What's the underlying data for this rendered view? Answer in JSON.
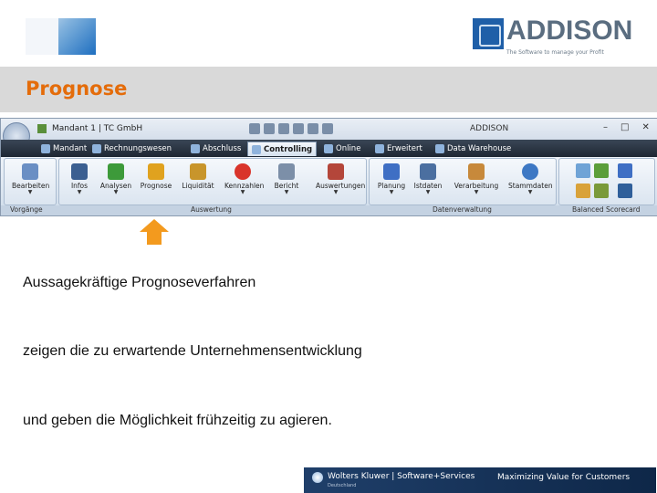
{
  "header": {
    "title": "Prognose",
    "logo_word": "ADDISON",
    "logo_tagline": "The Software to manage your Profit",
    "accent_color": "#e46c0a"
  },
  "app": {
    "window_title": "Mandant 1 | TC GmbH",
    "app_name": "ADDISON",
    "window_buttons": [
      "–",
      "□",
      "✕"
    ],
    "tabs": [
      {
        "label": "Mandant",
        "icon": "client-icon",
        "active": false
      },
      {
        "label": "Rechnungswesen",
        "icon": "ledger-icon",
        "active": false
      },
      {
        "label": "Abschluss",
        "icon": "closing-icon",
        "active": false
      },
      {
        "label": "Controlling",
        "icon": "controlling-icon",
        "active": true
      },
      {
        "label": "Online",
        "icon": "globe-icon",
        "active": false
      },
      {
        "label": "Erweitert",
        "icon": "gear-icon",
        "active": false
      },
      {
        "label": "Data Warehouse",
        "icon": "warehouse-icon",
        "active": false
      }
    ],
    "ribbon_buttons": [
      {
        "label": "Bearbeiten",
        "icon": "edit-icon",
        "color": "#6a8fc4"
      },
      {
        "label": "Infos",
        "icon": "info-icon",
        "color": "#3b5f91"
      },
      {
        "label": "Analysen",
        "icon": "traffic-light-icon",
        "color": "#3d9a3a"
      },
      {
        "label": "Prognose",
        "icon": "forecast-icon",
        "color": "#e0a21f"
      },
      {
        "label": "Liquidität",
        "icon": "liquidity-icon",
        "color": "#c8952b"
      },
      {
        "label": "Kennzahlen",
        "icon": "target-icon",
        "color": "#d9342b"
      },
      {
        "label": "Bericht",
        "icon": "report-icon",
        "color": "#7c8fa8"
      },
      {
        "label": "Auswertungen",
        "icon": "evaluations-icon",
        "color": "#b4463a"
      },
      {
        "label": "Planung",
        "icon": "planning-arrow-icon",
        "color": "#3f6fc4"
      },
      {
        "label": "Istdaten",
        "icon": "actual-data-icon",
        "color": "#4b6fa0"
      },
      {
        "label": "Verarbeitung",
        "icon": "processing-icon",
        "color": "#c7893b"
      },
      {
        "label": "Stammdaten",
        "icon": "master-data-icon",
        "color": "#3d78c4"
      }
    ],
    "groups": [
      "Vorgänge",
      "Auswertung",
      "Datenverwaltung",
      "Balanced Scorecard"
    ]
  },
  "body": {
    "line1": "Aussagekräftige Prognoseverfahren",
    "line2": "zeigen die zu erwartende Unternehmensentwicklung",
    "line3": "und geben die Möglichkeit frühzeitig zu agieren."
  },
  "footer": {
    "brand": "Wolters Kluwer | Software+Services",
    "brand_sub": "Deutschland",
    "claim": "Maximizing Value for Customers"
  }
}
